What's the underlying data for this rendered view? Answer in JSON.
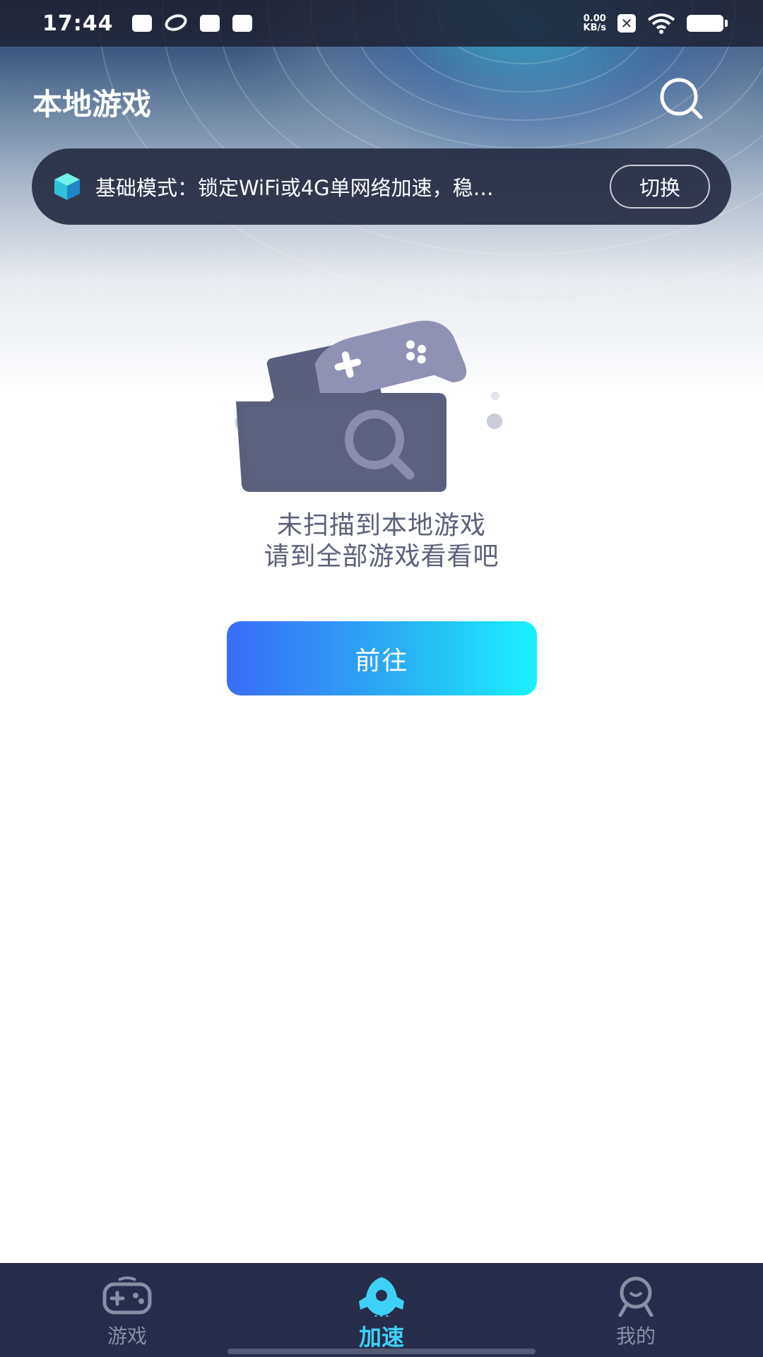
{
  "status_bar": {
    "time": "17:44",
    "net_speed_value": "0.00",
    "net_speed_unit": "KB/s",
    "sim_status": "✕"
  },
  "header": {
    "title": "本地游戏",
    "search_icon": "search-icon"
  },
  "mode_banner": {
    "icon": "cube-icon",
    "text": "基础模式：锁定WiFi或4G单网络加速，稳…",
    "switch_label": "切换"
  },
  "empty_state": {
    "line1": "未扫描到本地游戏",
    "line2": "请到全部游戏看看吧",
    "button_label": "前往"
  },
  "bottom_nav": {
    "items": [
      {
        "label": "游戏",
        "icon": "gamepad-icon",
        "active": false
      },
      {
        "label": "加速",
        "icon": "rocket-icon",
        "active": true
      },
      {
        "label": "我的",
        "icon": "profile-icon",
        "active": false
      }
    ]
  },
  "colors": {
    "banner_bg": "#262c42",
    "nav_bg": "#262d4a",
    "active_tab": "#3ed1f5",
    "button_start": "#3a6cf8",
    "button_end": "#19f2fb",
    "empty_text": "#5c6079"
  }
}
